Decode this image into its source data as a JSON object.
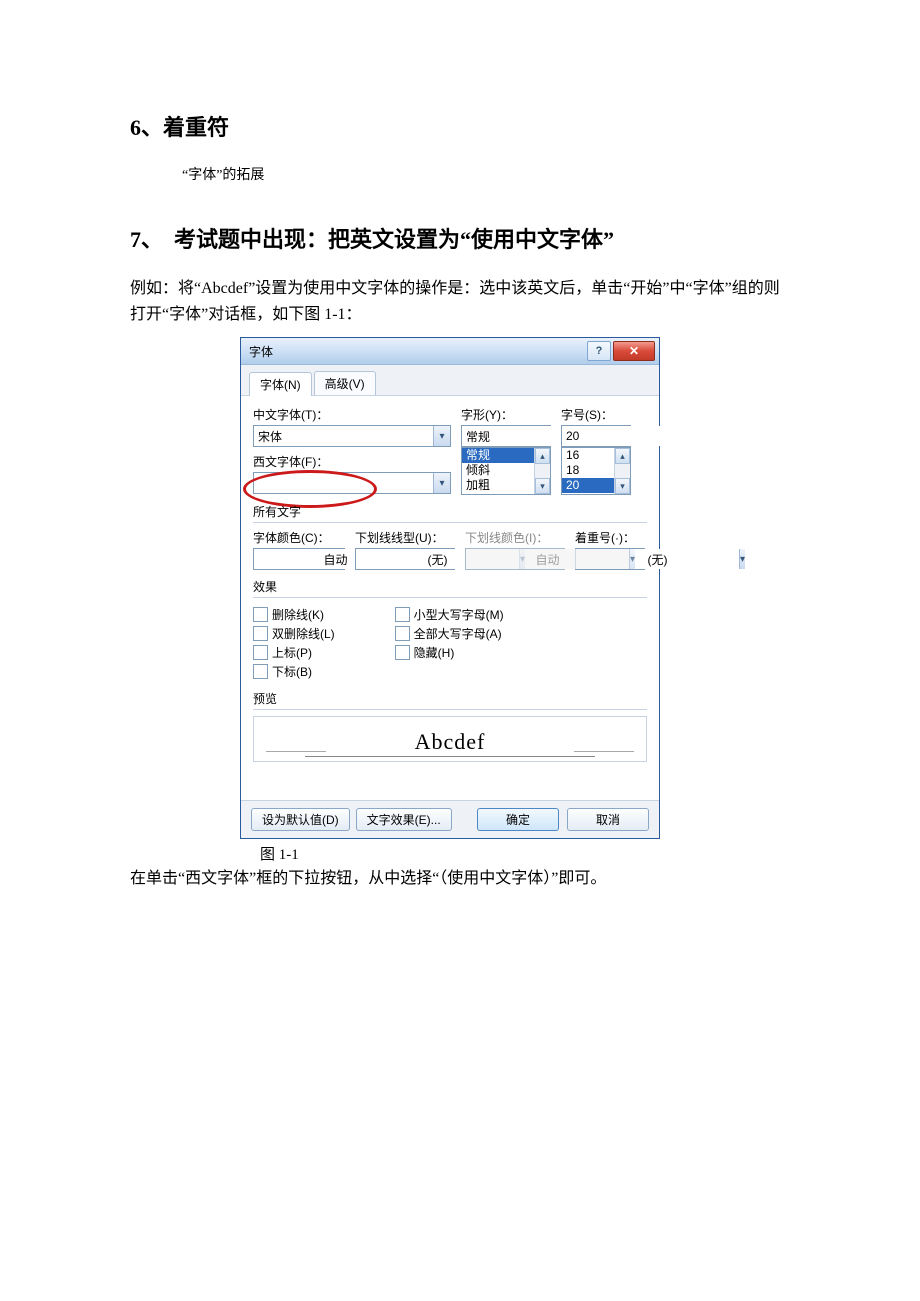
{
  "doc": {
    "section6": "6、着重符",
    "section6_note": "“字体”的拓展",
    "section7": "7、　考试题中出现：把英文设置为“使用中文字体”",
    "paragraph1": "例如：将“Abcdef”设置为使用中文字体的操作是：选中该英文后，单击“开始”中“字体”组的则打开“字体”对话框，如下图 1-1：",
    "caption": "图 1-1",
    "paragraph2": "在单击“西文字体”框的下拉按钮，从中选择“（使用中文字体）”即可。"
  },
  "dialog": {
    "title": "字体",
    "tab1": "字体(N)",
    "tab2": "高级(V)",
    "lbl_cn_font": "中文字体(T)：",
    "val_cn_font": "宋体",
    "lbl_en_font": "西文字体(F)：",
    "val_en_font": "",
    "lbl_style": "字形(Y)：",
    "val_style": "常规",
    "style_opts": [
      "常规",
      "倾斜",
      "加粗"
    ],
    "lbl_size": "字号(S)：",
    "val_size": "20",
    "size_opts": [
      "16",
      "18",
      "20"
    ],
    "group_alltext": "所有文字",
    "lbl_font_color": "字体颜色(C)：",
    "val_font_color": "自动",
    "lbl_underline_style": "下划线线型(U)：",
    "val_underline_style": "(无)",
    "lbl_underline_color": "下划线颜色(I)：",
    "val_underline_color": "自动",
    "lbl_emphasis": "着重号(·)：",
    "val_emphasis": "(无)",
    "group_effects": "效果",
    "chk_strike": "删除线(K)",
    "chk_dstrike": "双删除线(L)",
    "chk_super": "上标(P)",
    "chk_sub": "下标(B)",
    "chk_smallcaps": "小型大写字母(M)",
    "chk_allcaps": "全部大写字母(A)",
    "chk_hidden": "隐藏(H)",
    "group_preview": "预览",
    "preview_text": "Abcdef",
    "btn_default": "设为默认值(D)",
    "btn_texteffect": "文字效果(E)...",
    "btn_ok": "确定",
    "btn_cancel": "取消"
  }
}
